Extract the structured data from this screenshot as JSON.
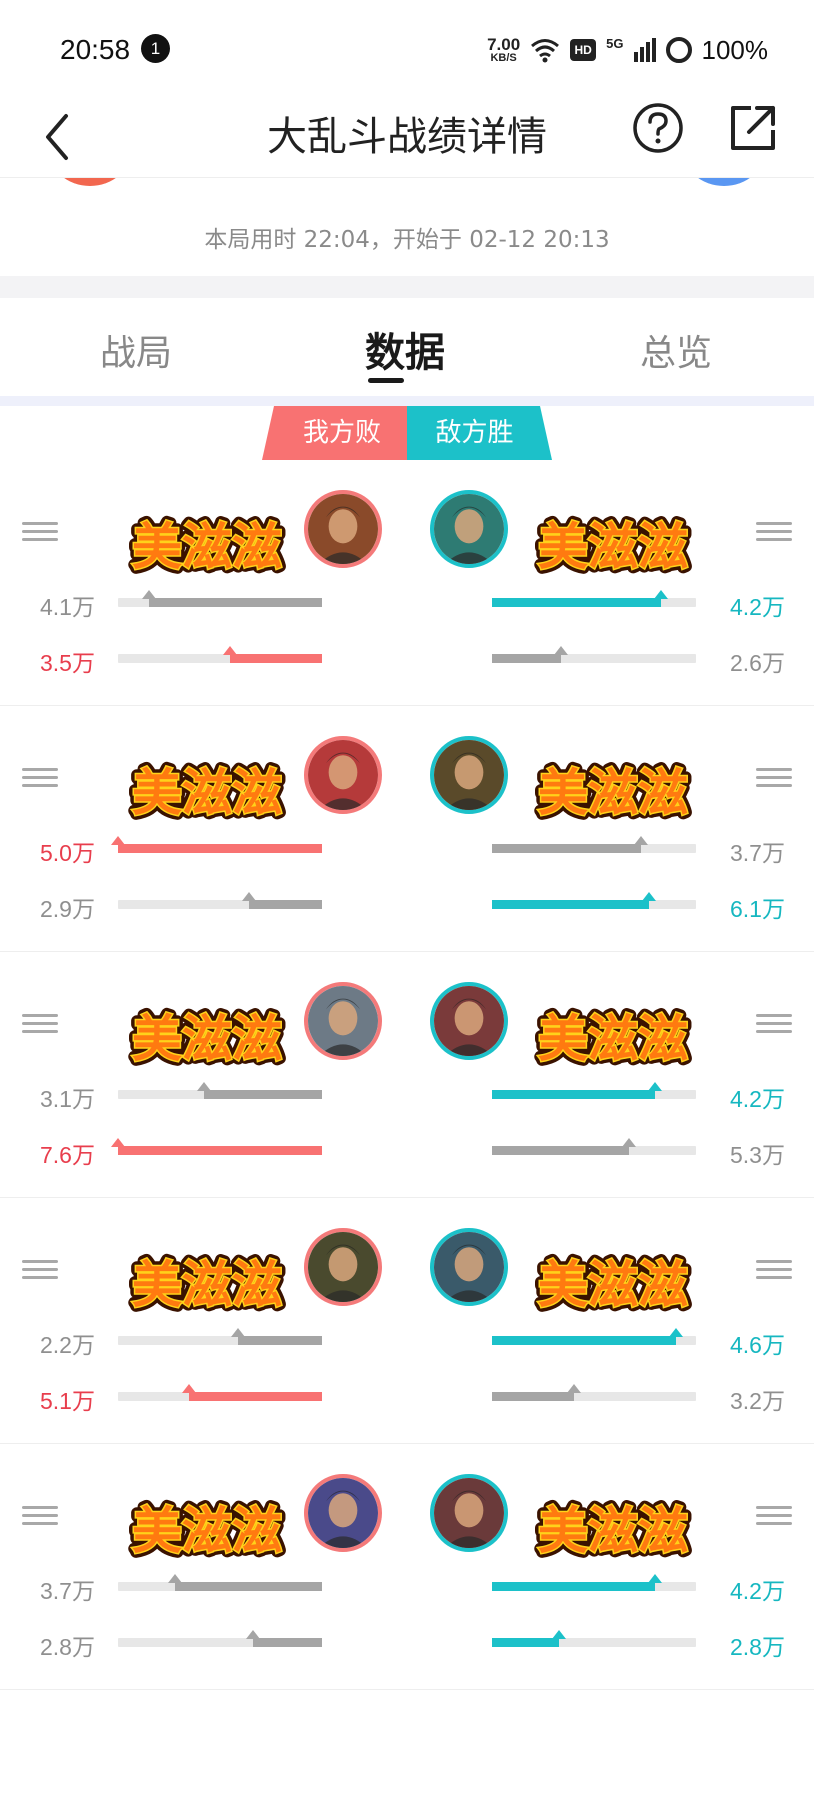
{
  "status_bar": {
    "time": "20:58",
    "notification_count": "1",
    "net_speed": "7.00",
    "net_speed_unit": "KB/S",
    "hd_label": "HD",
    "network_type": "5G",
    "battery": "100%"
  },
  "header": {
    "title": "大乱斗战绩详情",
    "back_icon": "chevron-left-icon",
    "help_icon": "question-circle-icon",
    "share_icon": "share-external-icon"
  },
  "match": {
    "time_info": "本局用时 22:04，开始于 02-12 20:13",
    "our_color": "#f2674f",
    "enemy_color": "#5a97f2"
  },
  "tabs": [
    {
      "label": "战局",
      "active": false
    },
    {
      "label": "数据",
      "active": true
    },
    {
      "label": "总览",
      "active": false
    }
  ],
  "result": {
    "our_label": "我方败",
    "enemy_label": "敌方胜",
    "our_color": "#f87272",
    "enemy_color": "#1cc1c9"
  },
  "sticker_text": "美滋滋",
  "colors": {
    "red_text": "#e83e4d",
    "teal_text": "#16b7c0",
    "gray_text": "#8f8f8f",
    "red_bar": "#f87272",
    "teal_bar": "#1cc1c9",
    "gray_bar": "#a5a5a5"
  },
  "players": [
    {
      "left": {
        "line1": {
          "value": "4.1万",
          "fraction": 0.85,
          "color": "gray"
        },
        "line2": {
          "value": "3.5万",
          "fraction": 0.45,
          "color": "red"
        }
      },
      "right": {
        "line1": {
          "value": "4.2万",
          "fraction": 0.83,
          "color": "teal"
        },
        "line2": {
          "value": "2.6万",
          "fraction": 0.34,
          "color": "gray"
        }
      }
    },
    {
      "left": {
        "line1": {
          "value": "5.0万",
          "fraction": 1.0,
          "color": "red"
        },
        "line2": {
          "value": "2.9万",
          "fraction": 0.36,
          "color": "gray"
        }
      },
      "right": {
        "line1": {
          "value": "3.7万",
          "fraction": 0.73,
          "color": "gray"
        },
        "line2": {
          "value": "6.1万",
          "fraction": 0.77,
          "color": "teal"
        }
      }
    },
    {
      "left": {
        "line1": {
          "value": "3.1万",
          "fraction": 0.58,
          "color": "gray"
        },
        "line2": {
          "value": "7.6万",
          "fraction": 1.0,
          "color": "red"
        }
      },
      "right": {
        "line1": {
          "value": "4.2万",
          "fraction": 0.8,
          "color": "teal"
        },
        "line2": {
          "value": "5.3万",
          "fraction": 0.67,
          "color": "gray"
        }
      }
    },
    {
      "left": {
        "line1": {
          "value": "2.2万",
          "fraction": 0.41,
          "color": "gray"
        },
        "line2": {
          "value": "5.1万",
          "fraction": 0.65,
          "color": "red"
        }
      },
      "right": {
        "line1": {
          "value": "4.6万",
          "fraction": 0.9,
          "color": "teal"
        },
        "line2": {
          "value": "3.2万",
          "fraction": 0.4,
          "color": "gray"
        }
      }
    },
    {
      "left": {
        "line1": {
          "value": "3.7万",
          "fraction": 0.72,
          "color": "gray"
        },
        "line2": {
          "value": "2.8万",
          "fraction": 0.34,
          "color": "gray"
        }
      },
      "right": {
        "line1": {
          "value": "4.2万",
          "fraction": 0.8,
          "color": "teal"
        },
        "line2": {
          "value": "2.8万",
          "fraction": 0.33,
          "color": "teal"
        }
      }
    }
  ]
}
